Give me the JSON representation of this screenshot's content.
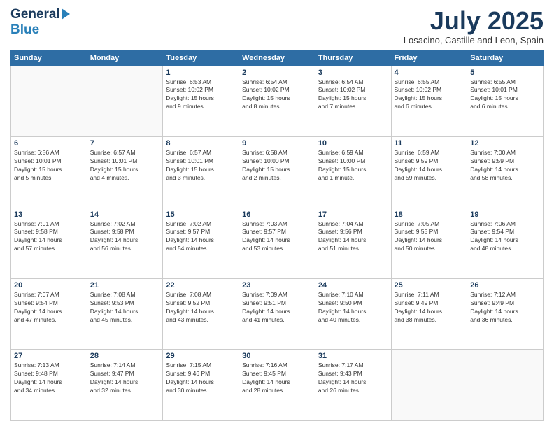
{
  "header": {
    "logo_general": "General",
    "logo_blue": "Blue",
    "month_title": "July 2025",
    "location": "Losacino, Castille and Leon, Spain"
  },
  "calendar": {
    "days_of_week": [
      "Sunday",
      "Monday",
      "Tuesday",
      "Wednesday",
      "Thursday",
      "Friday",
      "Saturday"
    ],
    "weeks": [
      [
        {
          "day": "",
          "info": ""
        },
        {
          "day": "",
          "info": ""
        },
        {
          "day": "1",
          "info": "Sunrise: 6:53 AM\nSunset: 10:02 PM\nDaylight: 15 hours\nand 9 minutes."
        },
        {
          "day": "2",
          "info": "Sunrise: 6:54 AM\nSunset: 10:02 PM\nDaylight: 15 hours\nand 8 minutes."
        },
        {
          "day": "3",
          "info": "Sunrise: 6:54 AM\nSunset: 10:02 PM\nDaylight: 15 hours\nand 7 minutes."
        },
        {
          "day": "4",
          "info": "Sunrise: 6:55 AM\nSunset: 10:02 PM\nDaylight: 15 hours\nand 6 minutes."
        },
        {
          "day": "5",
          "info": "Sunrise: 6:55 AM\nSunset: 10:01 PM\nDaylight: 15 hours\nand 6 minutes."
        }
      ],
      [
        {
          "day": "6",
          "info": "Sunrise: 6:56 AM\nSunset: 10:01 PM\nDaylight: 15 hours\nand 5 minutes."
        },
        {
          "day": "7",
          "info": "Sunrise: 6:57 AM\nSunset: 10:01 PM\nDaylight: 15 hours\nand 4 minutes."
        },
        {
          "day": "8",
          "info": "Sunrise: 6:57 AM\nSunset: 10:01 PM\nDaylight: 15 hours\nand 3 minutes."
        },
        {
          "day": "9",
          "info": "Sunrise: 6:58 AM\nSunset: 10:00 PM\nDaylight: 15 hours\nand 2 minutes."
        },
        {
          "day": "10",
          "info": "Sunrise: 6:59 AM\nSunset: 10:00 PM\nDaylight: 15 hours\nand 1 minute."
        },
        {
          "day": "11",
          "info": "Sunrise: 6:59 AM\nSunset: 9:59 PM\nDaylight: 14 hours\nand 59 minutes."
        },
        {
          "day": "12",
          "info": "Sunrise: 7:00 AM\nSunset: 9:59 PM\nDaylight: 14 hours\nand 58 minutes."
        }
      ],
      [
        {
          "day": "13",
          "info": "Sunrise: 7:01 AM\nSunset: 9:58 PM\nDaylight: 14 hours\nand 57 minutes."
        },
        {
          "day": "14",
          "info": "Sunrise: 7:02 AM\nSunset: 9:58 PM\nDaylight: 14 hours\nand 56 minutes."
        },
        {
          "day": "15",
          "info": "Sunrise: 7:02 AM\nSunset: 9:57 PM\nDaylight: 14 hours\nand 54 minutes."
        },
        {
          "day": "16",
          "info": "Sunrise: 7:03 AM\nSunset: 9:57 PM\nDaylight: 14 hours\nand 53 minutes."
        },
        {
          "day": "17",
          "info": "Sunrise: 7:04 AM\nSunset: 9:56 PM\nDaylight: 14 hours\nand 51 minutes."
        },
        {
          "day": "18",
          "info": "Sunrise: 7:05 AM\nSunset: 9:55 PM\nDaylight: 14 hours\nand 50 minutes."
        },
        {
          "day": "19",
          "info": "Sunrise: 7:06 AM\nSunset: 9:54 PM\nDaylight: 14 hours\nand 48 minutes."
        }
      ],
      [
        {
          "day": "20",
          "info": "Sunrise: 7:07 AM\nSunset: 9:54 PM\nDaylight: 14 hours\nand 47 minutes."
        },
        {
          "day": "21",
          "info": "Sunrise: 7:08 AM\nSunset: 9:53 PM\nDaylight: 14 hours\nand 45 minutes."
        },
        {
          "day": "22",
          "info": "Sunrise: 7:08 AM\nSunset: 9:52 PM\nDaylight: 14 hours\nand 43 minutes."
        },
        {
          "day": "23",
          "info": "Sunrise: 7:09 AM\nSunset: 9:51 PM\nDaylight: 14 hours\nand 41 minutes."
        },
        {
          "day": "24",
          "info": "Sunrise: 7:10 AM\nSunset: 9:50 PM\nDaylight: 14 hours\nand 40 minutes."
        },
        {
          "day": "25",
          "info": "Sunrise: 7:11 AM\nSunset: 9:49 PM\nDaylight: 14 hours\nand 38 minutes."
        },
        {
          "day": "26",
          "info": "Sunrise: 7:12 AM\nSunset: 9:49 PM\nDaylight: 14 hours\nand 36 minutes."
        }
      ],
      [
        {
          "day": "27",
          "info": "Sunrise: 7:13 AM\nSunset: 9:48 PM\nDaylight: 14 hours\nand 34 minutes."
        },
        {
          "day": "28",
          "info": "Sunrise: 7:14 AM\nSunset: 9:47 PM\nDaylight: 14 hours\nand 32 minutes."
        },
        {
          "day": "29",
          "info": "Sunrise: 7:15 AM\nSunset: 9:46 PM\nDaylight: 14 hours\nand 30 minutes."
        },
        {
          "day": "30",
          "info": "Sunrise: 7:16 AM\nSunset: 9:45 PM\nDaylight: 14 hours\nand 28 minutes."
        },
        {
          "day": "31",
          "info": "Sunrise: 7:17 AM\nSunset: 9:43 PM\nDaylight: 14 hours\nand 26 minutes."
        },
        {
          "day": "",
          "info": ""
        },
        {
          "day": "",
          "info": ""
        }
      ]
    ]
  }
}
